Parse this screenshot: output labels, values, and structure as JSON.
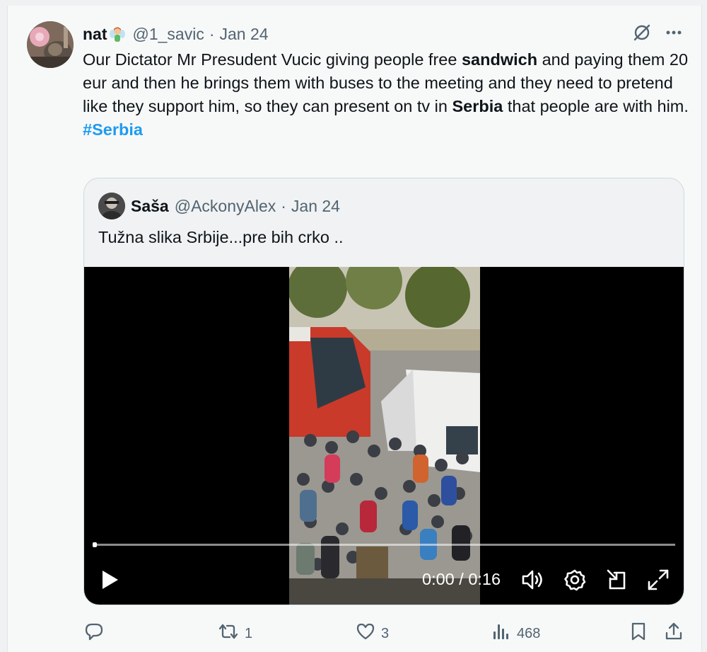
{
  "tweet": {
    "author_name": "nat",
    "author_handle": "@1_savic",
    "separator": "·",
    "date": "Jan 24",
    "text_parts": [
      {
        "text": "Our Dictator Mr Presudent Vucic giving people free ",
        "bold": false
      },
      {
        "text": "sandwich",
        "bold": true
      },
      {
        "text": " and paying them 20 eur and then he brings them with buses to the meeting and they need to pretend like they support him, so they can present on tv in ",
        "bold": false
      },
      {
        "text": "Serbia",
        "bold": true
      },
      {
        "text": " that people are with him.",
        "bold": false
      }
    ],
    "hashtag": "#Serbia",
    "icons": {
      "grok": "grok-icon",
      "more": "more-icon"
    }
  },
  "quote": {
    "author_name": "Saša",
    "author_handle": "@AckonyAlex",
    "separator": "·",
    "date": "Jan 24",
    "text": "Tužna slika Srbije...pre bih crko .."
  },
  "video": {
    "time": "0:00 / 0:16",
    "progress": 0.0,
    "icons": [
      "play-icon",
      "volume-icon",
      "settings-icon",
      "dock-icon",
      "fullscreen-icon"
    ]
  },
  "actions": {
    "replies": "",
    "reposts": "1",
    "likes": "3",
    "views": "468"
  },
  "colors": {
    "link": "#1d9bf0",
    "muted": "#536471",
    "text": "#0f1419"
  }
}
